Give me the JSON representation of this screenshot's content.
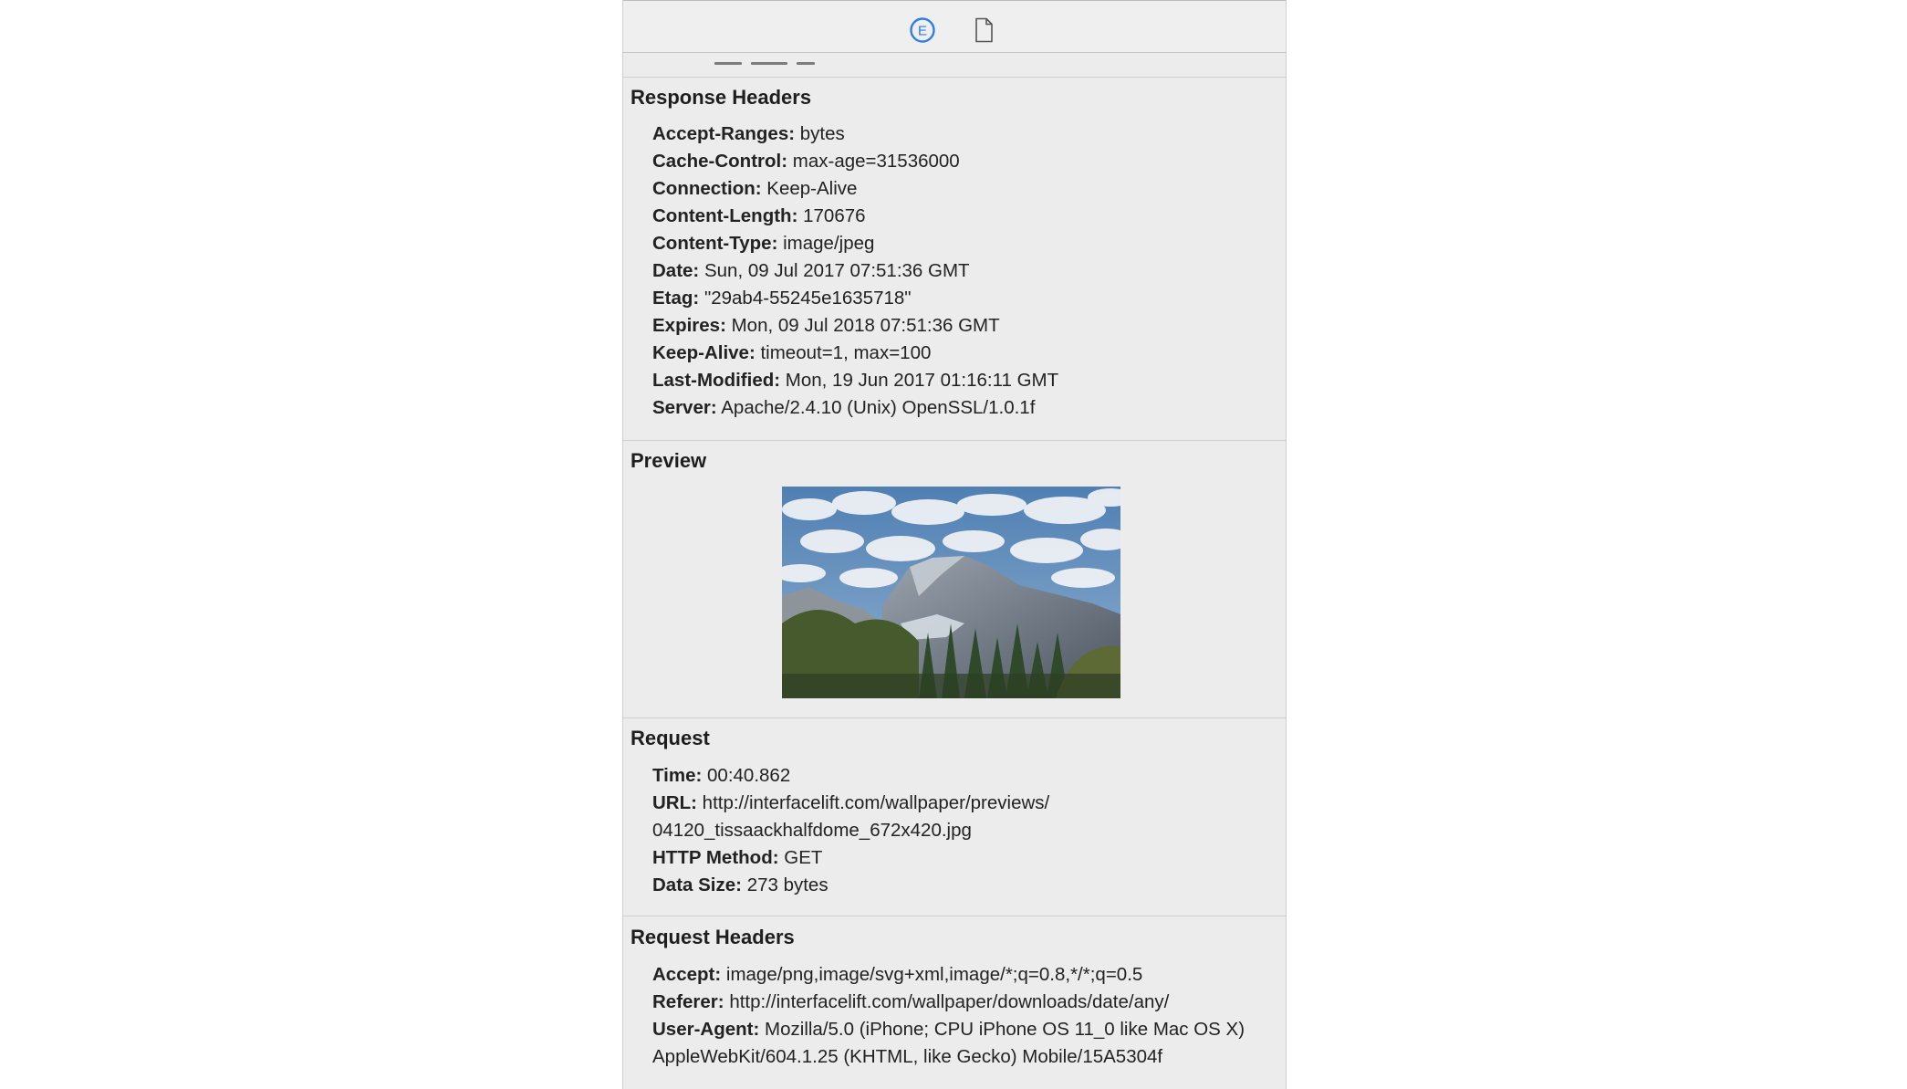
{
  "toolbar": {
    "icons": [
      "e-info-icon",
      "document-icon"
    ],
    "accent_color": "#2f7ee6"
  },
  "response_headers": {
    "title": "Response Headers",
    "rows": [
      {
        "key": "Accept-Ranges:",
        "value": "bytes"
      },
      {
        "key": "Cache-Control:",
        "value": "max-age=31536000"
      },
      {
        "key": "Connection:",
        "value": "Keep-Alive"
      },
      {
        "key": "Content-Length:",
        "value": "170676"
      },
      {
        "key": "Content-Type:",
        "value": "image/jpeg"
      },
      {
        "key": "Date:",
        "value": "Sun, 09 Jul 2017 07:51:36 GMT"
      },
      {
        "key": "Etag:",
        "value": "\"29ab4-55245e1635718\""
      },
      {
        "key": "Expires:",
        "value": "Mon, 09 Jul 2018 07:51:36 GMT"
      },
      {
        "key": "Keep-Alive:",
        "value": "timeout=1, max=100"
      },
      {
        "key": "Last-Modified:",
        "value": "Mon, 19 Jun 2017 01:16:11 GMT"
      },
      {
        "key": "Server:",
        "value": "Apache/2.4.10 (Unix) OpenSSL/1.0.1f"
      }
    ]
  },
  "preview": {
    "title": "Preview"
  },
  "request": {
    "title": "Request",
    "rows": [
      {
        "key": "Time:",
        "value": "00:40.862"
      },
      {
        "key": "URL:",
        "value": "http://interfacelift.com/wallpaper/previews/"
      },
      {
        "key": "",
        "value": "04120_tissaackhalfdome_672x420.jpg"
      },
      {
        "key": "HTTP Method:",
        "value": "GET"
      },
      {
        "key": "Data Size:",
        "value": "273 bytes"
      }
    ]
  },
  "request_headers": {
    "title": "Request Headers",
    "rows": [
      {
        "key": "Accept:",
        "value": "image/png,image/svg+xml,image/*;q=0.8,*/*;q=0.5"
      },
      {
        "key": "Referer:",
        "value": "http://interfacelift.com/wallpaper/downloads/date/any/"
      },
      {
        "key": "User-Agent:",
        "value": "Mozilla/5.0 (iPhone; CPU iPhone OS 11_0 like Mac OS X)"
      },
      {
        "key": "",
        "value": "AppleWebKit/604.1.25 (KHTML, like Gecko) Mobile/15A5304f"
      }
    ]
  }
}
